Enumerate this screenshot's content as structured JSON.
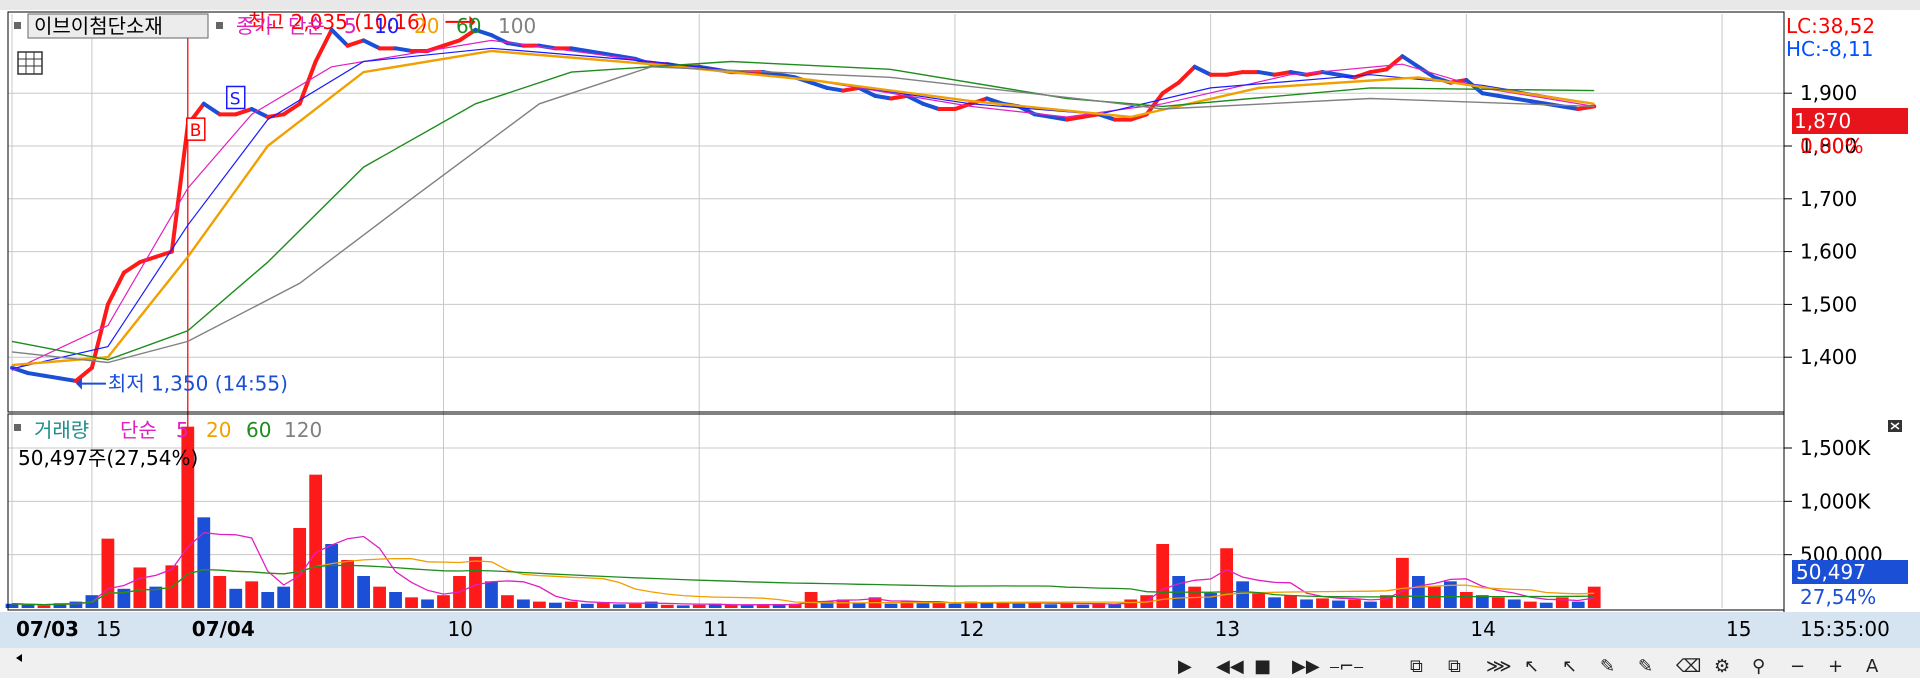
{
  "colors": {
    "up": "#ff1a1a",
    "down": "#1a4fd6",
    "ma5": "#e020c0",
    "ma10": "#1a1aff",
    "ma20": "#f0a000",
    "ma60": "#1e8c1e",
    "ma100": "#808080",
    "lc": "#ff0000",
    "hc": "#0050ff",
    "grid": "#c8c8c8",
    "frame": "#000000",
    "axis_bg": "#d8e4f0"
  },
  "chart_data": [
    {
      "type": "candlestick",
      "name": "price",
      "symbol": "이브이첨단소재",
      "legend": {
        "close_label": "종가",
        "ma_type": "단순",
        "periods": [
          "5",
          "10",
          "20",
          "60",
          "100"
        ]
      },
      "ylim": [
        1300,
        2050
      ],
      "y_ticks": [
        "1,400",
        "1,500",
        "1,600",
        "1,700",
        "1,800",
        "1,900"
      ],
      "limits": {
        "lc": "LC:38,52",
        "hc": "HC:-8,11"
      },
      "current": {
        "price": "1,870",
        "change": "0.00%"
      },
      "high_marker": {
        "label": "최고 2,035 (10:16)",
        "value": 2035
      },
      "low_marker": {
        "label": "최저 1,350 (14:55)",
        "value": 1350
      },
      "signals": [
        {
          "label": "B",
          "value": 1830
        },
        {
          "label": "S",
          "value": 1890
        }
      ],
      "trend": [
        [
          0,
          1380
        ],
        [
          1,
          1370
        ],
        [
          2,
          1365
        ],
        [
          3,
          1360
        ],
        [
          4,
          1355
        ],
        [
          5,
          1380
        ],
        [
          6,
          1500
        ],
        [
          7,
          1560
        ],
        [
          8,
          1580
        ],
        [
          9,
          1590
        ],
        [
          10,
          1600
        ],
        [
          11,
          1840
        ],
        [
          12,
          1880
        ],
        [
          13,
          1860
        ],
        [
          14,
          1860
        ],
        [
          15,
          1870
        ],
        [
          16,
          1855
        ],
        [
          17,
          1860
        ],
        [
          18,
          1880
        ],
        [
          19,
          1960
        ],
        [
          20,
          2020
        ],
        [
          21,
          1990
        ],
        [
          22,
          2000
        ],
        [
          23,
          1985
        ],
        [
          24,
          1985
        ],
        [
          25,
          1980
        ],
        [
          26,
          1980
        ],
        [
          27,
          1990
        ],
        [
          28,
          2000
        ],
        [
          29,
          2020
        ],
        [
          30,
          2010
        ],
        [
          31,
          1995
        ],
        [
          32,
          1990
        ],
        [
          33,
          1990
        ],
        [
          34,
          1985
        ],
        [
          35,
          1985
        ],
        [
          36,
          1980
        ],
        [
          37,
          1975
        ],
        [
          38,
          1970
        ],
        [
          39,
          1965
        ],
        [
          40,
          1955
        ],
        [
          41,
          1955
        ],
        [
          42,
          1950
        ],
        [
          43,
          1950
        ],
        [
          44,
          1945
        ],
        [
          45,
          1940
        ],
        [
          46,
          1940
        ],
        [
          47,
          1940
        ],
        [
          48,
          1935
        ],
        [
          49,
          1930
        ],
        [
          50,
          1920
        ],
        [
          51,
          1910
        ],
        [
          52,
          1905
        ],
        [
          53,
          1910
        ],
        [
          54,
          1895
        ],
        [
          55,
          1890
        ],
        [
          56,
          1895
        ],
        [
          57,
          1880
        ],
        [
          58,
          1870
        ],
        [
          59,
          1870
        ],
        [
          60,
          1880
        ],
        [
          61,
          1890
        ],
        [
          62,
          1880
        ],
        [
          63,
          1875
        ],
        [
          64,
          1860
        ],
        [
          65,
          1855
        ],
        [
          66,
          1850
        ],
        [
          67,
          1855
        ],
        [
          68,
          1860
        ],
        [
          69,
          1850
        ],
        [
          70,
          1850
        ],
        [
          71,
          1860
        ],
        [
          72,
          1900
        ],
        [
          73,
          1920
        ],
        [
          74,
          1950
        ],
        [
          75,
          1935
        ],
        [
          76,
          1935
        ],
        [
          77,
          1940
        ],
        [
          78,
          1940
        ],
        [
          79,
          1935
        ],
        [
          80,
          1940
        ],
        [
          81,
          1935
        ],
        [
          82,
          1940
        ],
        [
          83,
          1935
        ],
        [
          84,
          1930
        ],
        [
          85,
          1940
        ],
        [
          86,
          1945
        ],
        [
          87,
          1970
        ],
        [
          88,
          1950
        ],
        [
          89,
          1930
        ],
        [
          90,
          1920
        ],
        [
          91,
          1925
        ],
        [
          92,
          1900
        ],
        [
          93,
          1895
        ],
        [
          94,
          1890
        ],
        [
          95,
          1885
        ],
        [
          96,
          1880
        ],
        [
          97,
          1875
        ],
        [
          98,
          1870
        ],
        [
          99,
          1875
        ]
      ],
      "ma": [
        {
          "period": "5",
          "points": [
            [
              0,
              1375
            ],
            [
              6,
              1460
            ],
            [
              11,
              1720
            ],
            [
              15,
              1860
            ],
            [
              20,
              1950
            ],
            [
              30,
              2000
            ],
            [
              40,
              1960
            ],
            [
              50,
              1925
            ],
            [
              60,
              1875
            ],
            [
              66,
              1855
            ],
            [
              72,
              1880
            ],
            [
              80,
              1935
            ],
            [
              87,
              1955
            ],
            [
              92,
              1910
            ],
            [
              99,
              1875
            ]
          ]
        },
        {
          "period": "10",
          "points": [
            [
              0,
              1378
            ],
            [
              6,
              1420
            ],
            [
              11,
              1650
            ],
            [
              16,
              1850
            ],
            [
              22,
              1960
            ],
            [
              30,
              1985
            ],
            [
              40,
              1960
            ],
            [
              50,
              1925
            ],
            [
              60,
              1880
            ],
            [
              68,
              1860
            ],
            [
              75,
              1910
            ],
            [
              85,
              1935
            ],
            [
              92,
              1915
            ],
            [
              99,
              1880
            ]
          ]
        },
        {
          "period": "20",
          "points": [
            [
              0,
              1385
            ],
            [
              6,
              1400
            ],
            [
              11,
              1590
            ],
            [
              16,
              1800
            ],
            [
              22,
              1940
            ],
            [
              30,
              1980
            ],
            [
              40,
              1955
            ],
            [
              50,
              1925
            ],
            [
              60,
              1885
            ],
            [
              70,
              1855
            ],
            [
              78,
              1910
            ],
            [
              88,
              1930
            ],
            [
              99,
              1880
            ]
          ]
        },
        {
          "period": "60",
          "points": [
            [
              0,
              1430
            ],
            [
              6,
              1395
            ],
            [
              11,
              1450
            ],
            [
              16,
              1580
            ],
            [
              22,
              1760
            ],
            [
              29,
              1880
            ],
            [
              35,
              1940
            ],
            [
              45,
              1960
            ],
            [
              55,
              1945
            ],
            [
              66,
              1890
            ],
            [
              72,
              1875
            ],
            [
              85,
              1910
            ],
            [
              99,
              1905
            ]
          ]
        },
        {
          "period": "100",
          "points": [
            [
              0,
              1410
            ],
            [
              6,
              1390
            ],
            [
              11,
              1430
            ],
            [
              18,
              1540
            ],
            [
              25,
              1700
            ],
            [
              33,
              1880
            ],
            [
              40,
              1950
            ],
            [
              55,
              1930
            ],
            [
              68,
              1885
            ],
            [
              72,
              1870
            ],
            [
              85,
              1890
            ],
            [
              99,
              1875
            ]
          ]
        }
      ]
    },
    {
      "type": "bar",
      "name": "volume",
      "legend": {
        "label": "거래량",
        "ma_type": "단순",
        "periods": [
          "5",
          "20",
          "60",
          "120"
        ]
      },
      "summary": "50,497주(27,54%)",
      "ylim": [
        0,
        1800000
      ],
      "y_ticks": [
        "500,000",
        "1,000K",
        "1,500K"
      ],
      "current": {
        "volume": "50,497",
        "ratio": "27,54%"
      },
      "bars": [
        [
          0,
          40000,
          "down"
        ],
        [
          1,
          30000,
          "down"
        ],
        [
          2,
          25000,
          "up"
        ],
        [
          3,
          45000,
          "down"
        ],
        [
          4,
          60000,
          "down"
        ],
        [
          5,
          120000,
          "down"
        ],
        [
          6,
          650000,
          "up"
        ],
        [
          7,
          180000,
          "down"
        ],
        [
          8,
          380000,
          "up"
        ],
        [
          9,
          200000,
          "down"
        ],
        [
          10,
          400000,
          "up"
        ],
        [
          11,
          1700000,
          "up"
        ],
        [
          12,
          850000,
          "down"
        ],
        [
          13,
          300000,
          "up"
        ],
        [
          14,
          180000,
          "down"
        ],
        [
          15,
          250000,
          "up"
        ],
        [
          16,
          150000,
          "down"
        ],
        [
          17,
          200000,
          "down"
        ],
        [
          18,
          750000,
          "up"
        ],
        [
          19,
          1250000,
          "up"
        ],
        [
          20,
          600000,
          "down"
        ],
        [
          21,
          450000,
          "up"
        ],
        [
          22,
          300000,
          "down"
        ],
        [
          23,
          200000,
          "up"
        ],
        [
          24,
          150000,
          "down"
        ],
        [
          25,
          100000,
          "up"
        ],
        [
          26,
          80000,
          "down"
        ],
        [
          27,
          120000,
          "up"
        ],
        [
          28,
          300000,
          "up"
        ],
        [
          29,
          480000,
          "up"
        ],
        [
          30,
          250000,
          "down"
        ],
        [
          31,
          120000,
          "up"
        ],
        [
          32,
          80000,
          "down"
        ],
        [
          33,
          60000,
          "up"
        ],
        [
          34,
          50000,
          "down"
        ],
        [
          35,
          60000,
          "up"
        ],
        [
          36,
          40000,
          "down"
        ],
        [
          37,
          50000,
          "up"
        ],
        [
          38,
          35000,
          "down"
        ],
        [
          39,
          40000,
          "up"
        ],
        [
          40,
          60000,
          "down"
        ],
        [
          41,
          30000,
          "up"
        ],
        [
          42,
          25000,
          "down"
        ],
        [
          43,
          30000,
          "up"
        ],
        [
          44,
          40000,
          "down"
        ],
        [
          45,
          30000,
          "up"
        ],
        [
          46,
          25000,
          "down"
        ],
        [
          47,
          30000,
          "up"
        ],
        [
          48,
          35000,
          "down"
        ],
        [
          49,
          40000,
          "up"
        ],
        [
          50,
          150000,
          "up"
        ],
        [
          51,
          60000,
          "down"
        ],
        [
          52,
          80000,
          "up"
        ],
        [
          53,
          50000,
          "down"
        ],
        [
          54,
          100000,
          "up"
        ],
        [
          55,
          40000,
          "down"
        ],
        [
          56,
          60000,
          "up"
        ],
        [
          57,
          45000,
          "down"
        ],
        [
          58,
          50000,
          "up"
        ],
        [
          59,
          40000,
          "down"
        ],
        [
          60,
          60000,
          "up"
        ],
        [
          61,
          45000,
          "down"
        ],
        [
          62,
          50000,
          "up"
        ],
        [
          63,
          40000,
          "down"
        ],
        [
          64,
          55000,
          "up"
        ],
        [
          65,
          35000,
          "down"
        ],
        [
          66,
          40000,
          "up"
        ],
        [
          67,
          30000,
          "down"
        ],
        [
          68,
          45000,
          "up"
        ],
        [
          69,
          35000,
          "down"
        ],
        [
          70,
          80000,
          "up"
        ],
        [
          71,
          120000,
          "up"
        ],
        [
          72,
          600000,
          "up"
        ],
        [
          73,
          300000,
          "down"
        ],
        [
          74,
          200000,
          "up"
        ],
        [
          75,
          140000,
          "down"
        ],
        [
          76,
          560000,
          "up"
        ],
        [
          77,
          250000,
          "down"
        ],
        [
          78,
          150000,
          "up"
        ],
        [
          79,
          100000,
          "down"
        ],
        [
          80,
          120000,
          "up"
        ],
        [
          81,
          80000,
          "down"
        ],
        [
          82,
          90000,
          "up"
        ],
        [
          83,
          70000,
          "down"
        ],
        [
          84,
          80000,
          "up"
        ],
        [
          85,
          60000,
          "down"
        ],
        [
          86,
          120000,
          "up"
        ],
        [
          87,
          470000,
          "up"
        ],
        [
          88,
          300000,
          "down"
        ],
        [
          89,
          200000,
          "up"
        ],
        [
          90,
          250000,
          "down"
        ],
        [
          91,
          150000,
          "up"
        ],
        [
          92,
          120000,
          "down"
        ],
        [
          93,
          100000,
          "up"
        ],
        [
          94,
          80000,
          "down"
        ],
        [
          95,
          60000,
          "up"
        ],
        [
          96,
          50000,
          "down"
        ],
        [
          97,
          100000,
          "up"
        ],
        [
          98,
          60000,
          "down"
        ],
        [
          99,
          200000,
          "up"
        ]
      ]
    }
  ],
  "x_axis": {
    "labels": [
      {
        "i": 0,
        "text": "07/03",
        "bold": true
      },
      {
        "i": 5,
        "text": "15",
        "bold": false
      },
      {
        "i": 11,
        "text": "07/04",
        "bold": true
      },
      {
        "i": 27,
        "text": "10",
        "bold": false
      },
      {
        "i": 43,
        "text": "11",
        "bold": false
      },
      {
        "i": 59,
        "text": "12",
        "bold": false
      },
      {
        "i": 75,
        "text": "13",
        "bold": false
      },
      {
        "i": 91,
        "text": "14",
        "bold": false
      },
      {
        "i": 107,
        "text": "15",
        "bold": false
      }
    ],
    "time": "15:35:00"
  },
  "toolbar": {
    "icons": [
      "arrow-left-icon",
      "play-icon",
      "rewind-icon",
      "stop-icon",
      "fast-forward-icon",
      "zoom-slider-icon",
      "window-icon",
      "window-2-icon",
      "stack-icon",
      "cursor-icon",
      "cursor-2-icon",
      "pencil-icon",
      "pencil-2-icon",
      "eraser-icon",
      "settings-icon",
      "search-icon",
      "minus-icon",
      "plus-icon",
      "text-icon"
    ]
  }
}
